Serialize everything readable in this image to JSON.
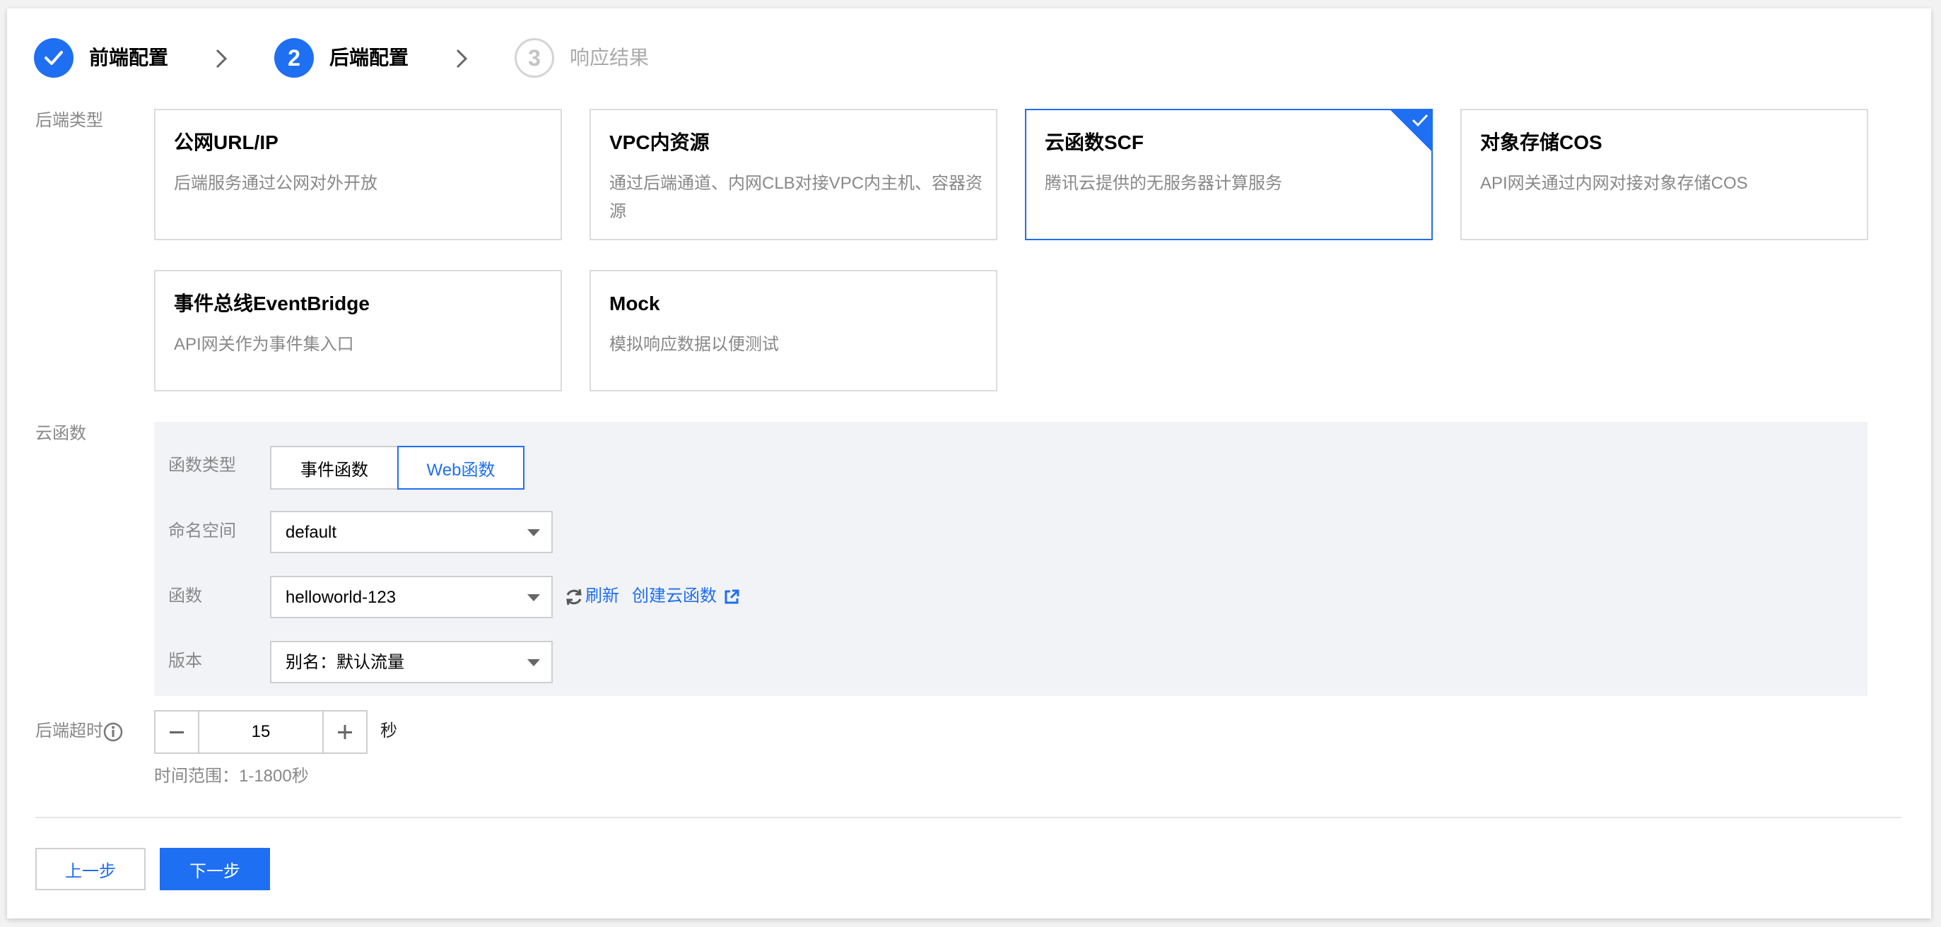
{
  "steps": [
    {
      "label": "前端配置",
      "state": "done"
    },
    {
      "number": "2",
      "label": "后端配置",
      "state": "active"
    },
    {
      "number": "3",
      "label": "响应结果",
      "state": "todo"
    }
  ],
  "backend_type": {
    "label": "后端类型",
    "cards": [
      {
        "title": "公网URL/IP",
        "desc": "后端服务通过公网对外开放",
        "selected": false
      },
      {
        "title": "VPC内资源",
        "desc": "通过后端通道、内网CLB对接VPC内主机、容器资源",
        "selected": false
      },
      {
        "title": "云函数SCF",
        "desc": "腾讯云提供的无服务器计算服务",
        "selected": true
      },
      {
        "title": "对象存储COS",
        "desc": "API网关通过内网对接对象存储COS",
        "selected": false
      },
      {
        "title": "事件总线EventBridge",
        "desc": "API网关作为事件集入口",
        "selected": false
      },
      {
        "title": "Mock",
        "desc": "模拟响应数据以便测试",
        "selected": false
      }
    ]
  },
  "scf": {
    "label": "云函数",
    "function_type": {
      "label": "函数类型",
      "options": [
        "事件函数",
        "Web函数"
      ],
      "selected": "Web函数"
    },
    "namespace": {
      "label": "命名空间",
      "value": "default"
    },
    "function": {
      "label": "函数",
      "value": "helloworld-123",
      "refresh": "刷新",
      "create": "创建云函数"
    },
    "version": {
      "label": "版本",
      "value": "别名：默认流量"
    }
  },
  "timeout": {
    "label": "后端超时",
    "value": "15",
    "unit": "秒",
    "hint": "时间范围：1-1800秒"
  },
  "buttons": {
    "prev": "上一步",
    "next": "下一步"
  },
  "colors": {
    "accent": "#1e6ff1",
    "panel_bg": "#f2f3f7",
    "muted_text": "#888888"
  }
}
